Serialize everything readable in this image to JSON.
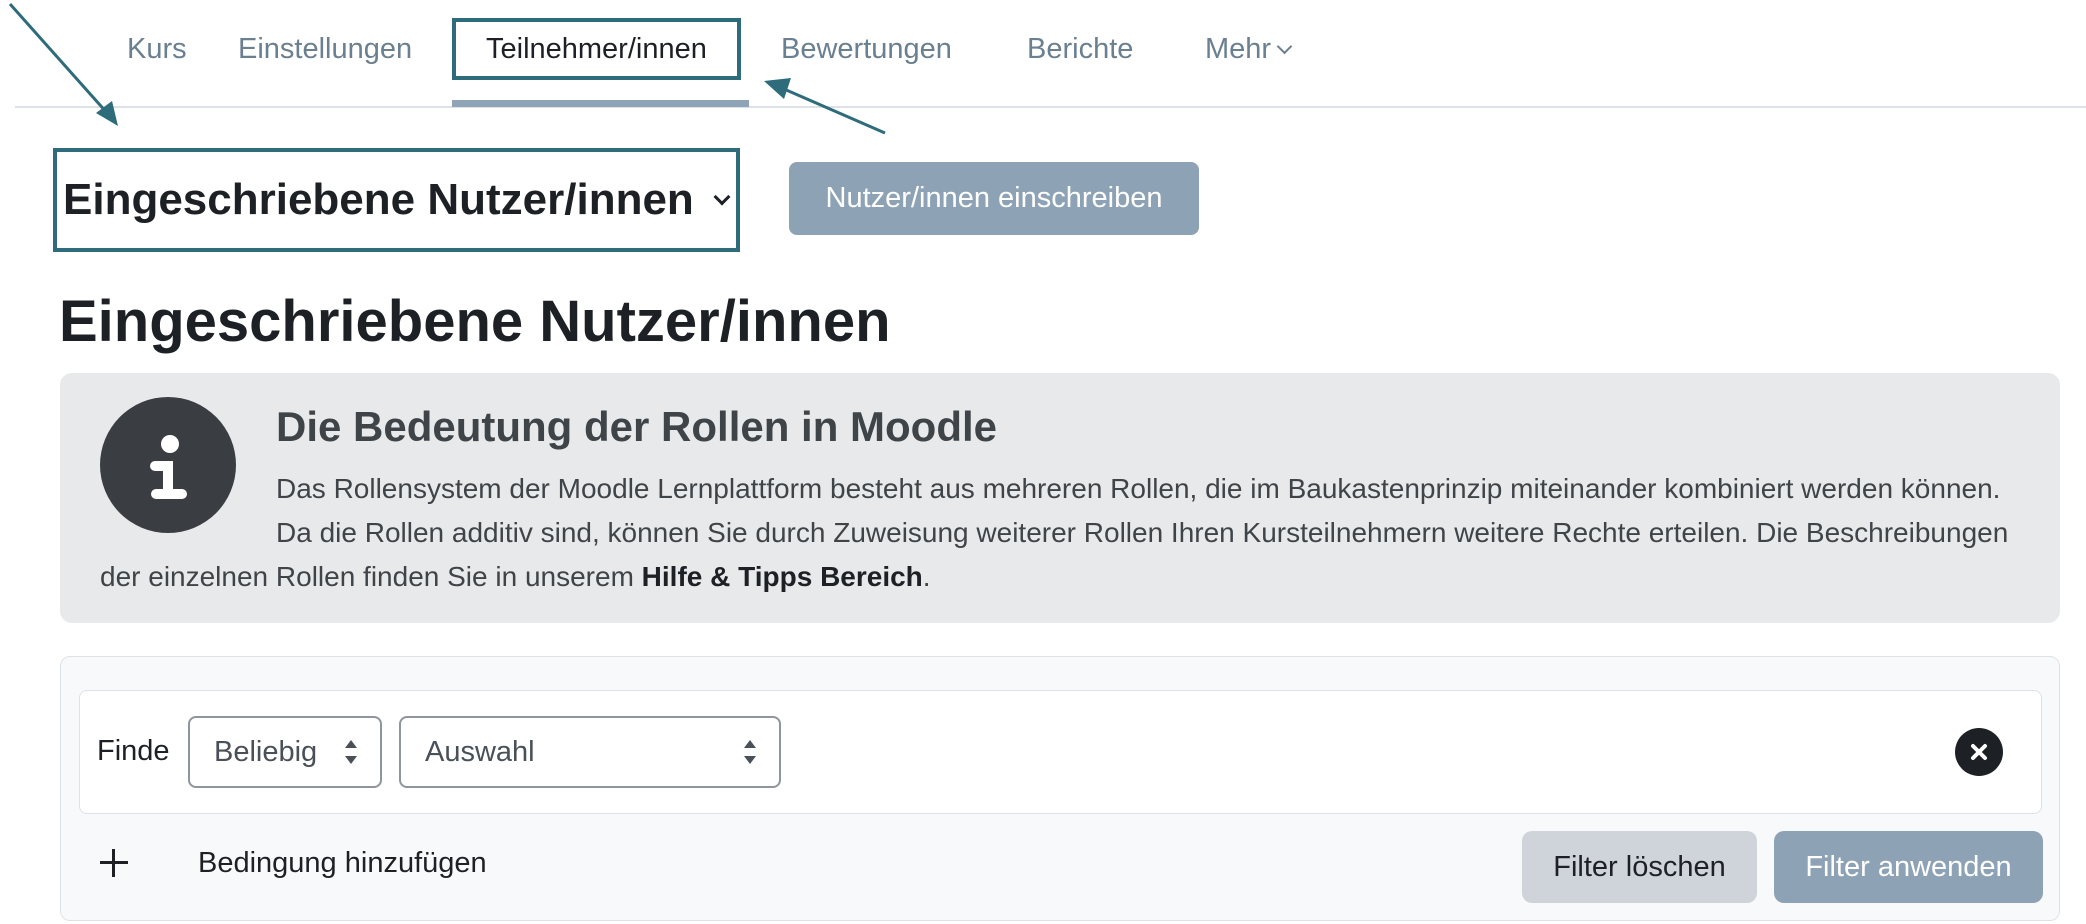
{
  "nav": {
    "items": [
      {
        "label": "Kurs"
      },
      {
        "label": "Einstellungen"
      },
      {
        "label": "Teilnehmer/innen",
        "active": true
      },
      {
        "label": "Bewertungen"
      },
      {
        "label": "Berichte"
      },
      {
        "label": "Mehr"
      }
    ]
  },
  "heading_select": {
    "label": "Eingeschriebene Nutzer/innen"
  },
  "enrol_button": {
    "label": "Nutzer/innen einschreiben"
  },
  "page_title": "Eingeschriebene Nutzer/innen",
  "infobox": {
    "title": "Die Bedeutung der Rollen in Moodle",
    "text": "Das Rollensystem der Moodle Lernplattform besteht aus mehreren Rollen, die im Baukastenprinzip miteinander kombiniert werden können. Da die Rollen additiv sind, können Sie durch Zuweisung weiterer Rollen Ihren Kursteilnehmern weitere Rechte erteilen. Die Beschreibungen der einzelnen Rollen finden Sie in unserem ",
    "link_text": "Hilfe & Tipps Bereich",
    "text_end": "."
  },
  "filter": {
    "find_label": "Finde",
    "match_select": "Beliebig",
    "type_select": "Auswahl",
    "add_condition_label": "Bedingung hinzufügen",
    "clear_button": "Filter löschen",
    "apply_button": "Filter anwenden"
  },
  "colors": {
    "accent": "#2e6b7b",
    "button_secondary": "#8da3b5",
    "info_bg": "#e8e9ea"
  }
}
